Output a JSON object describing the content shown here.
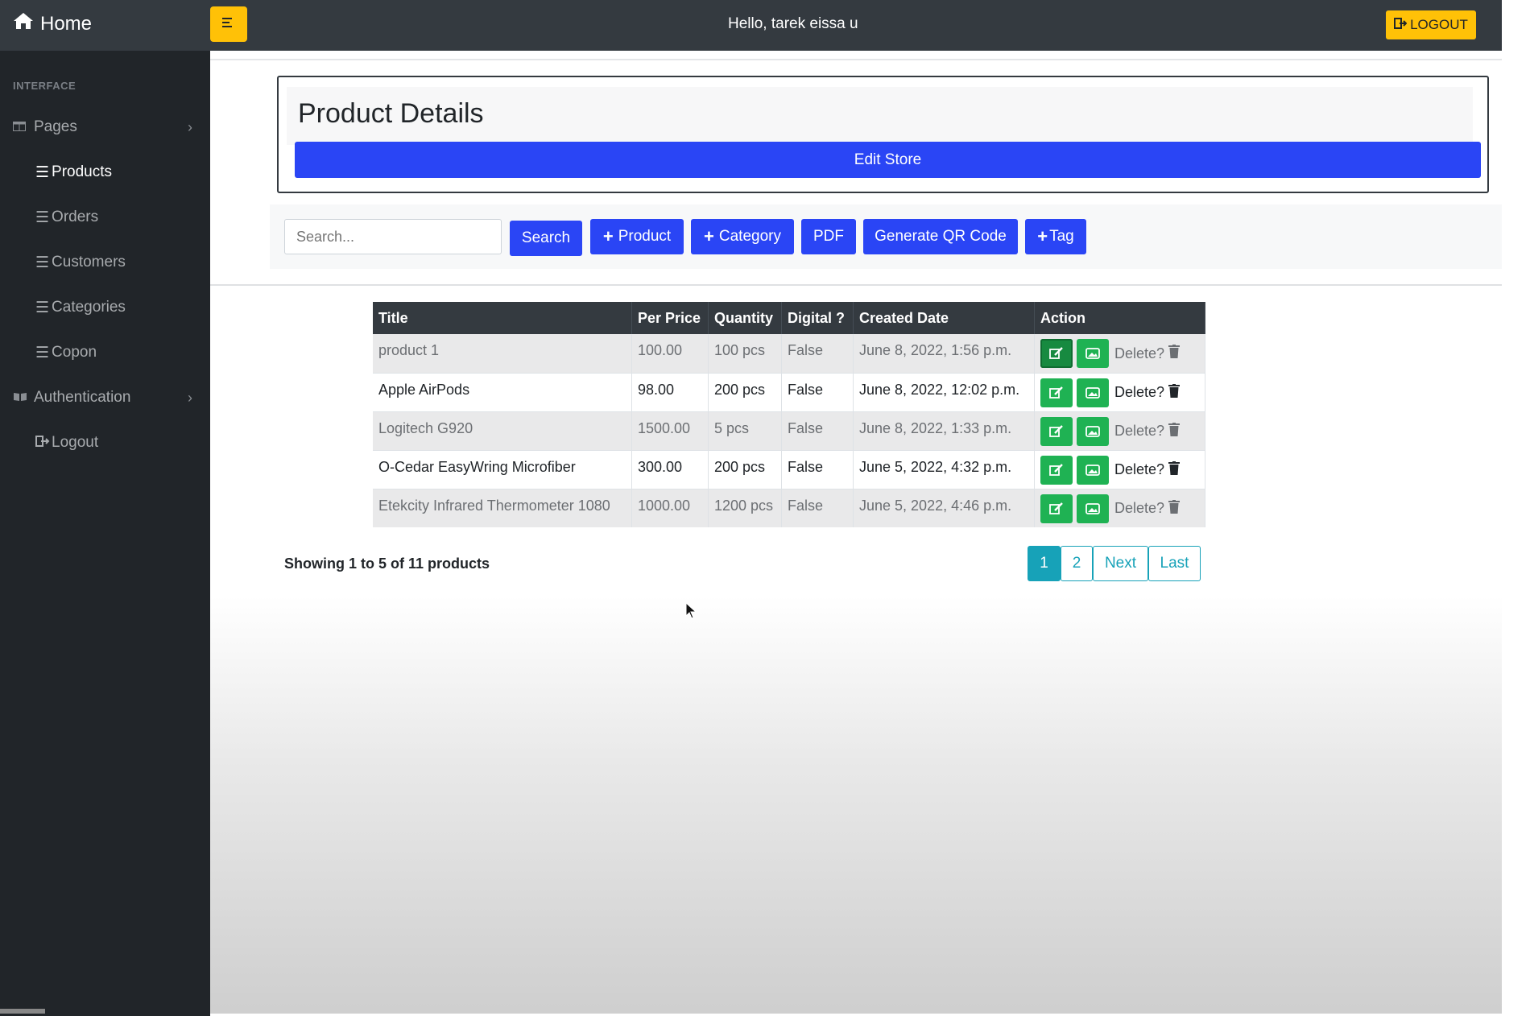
{
  "topbar": {
    "brand": "Home",
    "greeting": "Hello, tarek eissa u",
    "logout_label": "LOGOUT"
  },
  "sidebar": {
    "heading": "INTERFACE",
    "items": [
      {
        "label": "Pages"
      },
      {
        "label": "Products"
      },
      {
        "label": "Orders"
      },
      {
        "label": "Customers"
      },
      {
        "label": "Categories"
      },
      {
        "label": "Copon"
      },
      {
        "label": "Authentication"
      },
      {
        "label": "Logout"
      }
    ]
  },
  "details": {
    "title": "Product Details",
    "edit_store_label": "Edit Store"
  },
  "toolbar": {
    "search_placeholder": "Search...",
    "search_label": "Search",
    "add_product_label": "Product",
    "add_category_label": "Category",
    "pdf_label": "PDF",
    "qr_label": "Generate QR Code",
    "tag_label": "Tag"
  },
  "table": {
    "headers": [
      "Title",
      "Per Price",
      "Quantity",
      "Digital ?",
      "Created Date",
      "Action"
    ],
    "rows": [
      {
        "title": "product 1",
        "price": "100.00",
        "quantity": "100 pcs",
        "digital": "False",
        "created": "June 8, 2022, 1:56 p.m.",
        "delete": "Delete?"
      },
      {
        "title": "Apple AirPods",
        "price": "98.00",
        "quantity": "200 pcs",
        "digital": "False",
        "created": "June 8, 2022, 12:02 p.m.",
        "delete": "Delete?"
      },
      {
        "title": "Logitech G920",
        "price": "1500.00",
        "quantity": "5 pcs",
        "digital": "False",
        "created": "June 8, 2022, 1:33 p.m.",
        "delete": "Delete?"
      },
      {
        "title": "O-Cedar EasyWring Microfiber",
        "price": "300.00",
        "quantity": "200 pcs",
        "digital": "False",
        "created": "June 5, 2022, 4:32 p.m.",
        "delete": "Delete?"
      },
      {
        "title": "Etekcity Infrared Thermometer 1080",
        "price": "1000.00",
        "quantity": "1200 pcs",
        "digital": "False",
        "created": "June 5, 2022, 4:46 p.m.",
        "delete": "Delete?"
      }
    ]
  },
  "pagination": {
    "summary": "Showing 1 to 5 of 11 products",
    "pages": [
      "1",
      "2"
    ],
    "next_label": "Next",
    "last_label": "Last",
    "current": "1"
  },
  "colors": {
    "topbar": "#343a40",
    "sidebar": "#212529",
    "primary": "#2a45f5",
    "warning": "#ffc107",
    "success": "#1fb253",
    "info": "#17a2b8"
  }
}
